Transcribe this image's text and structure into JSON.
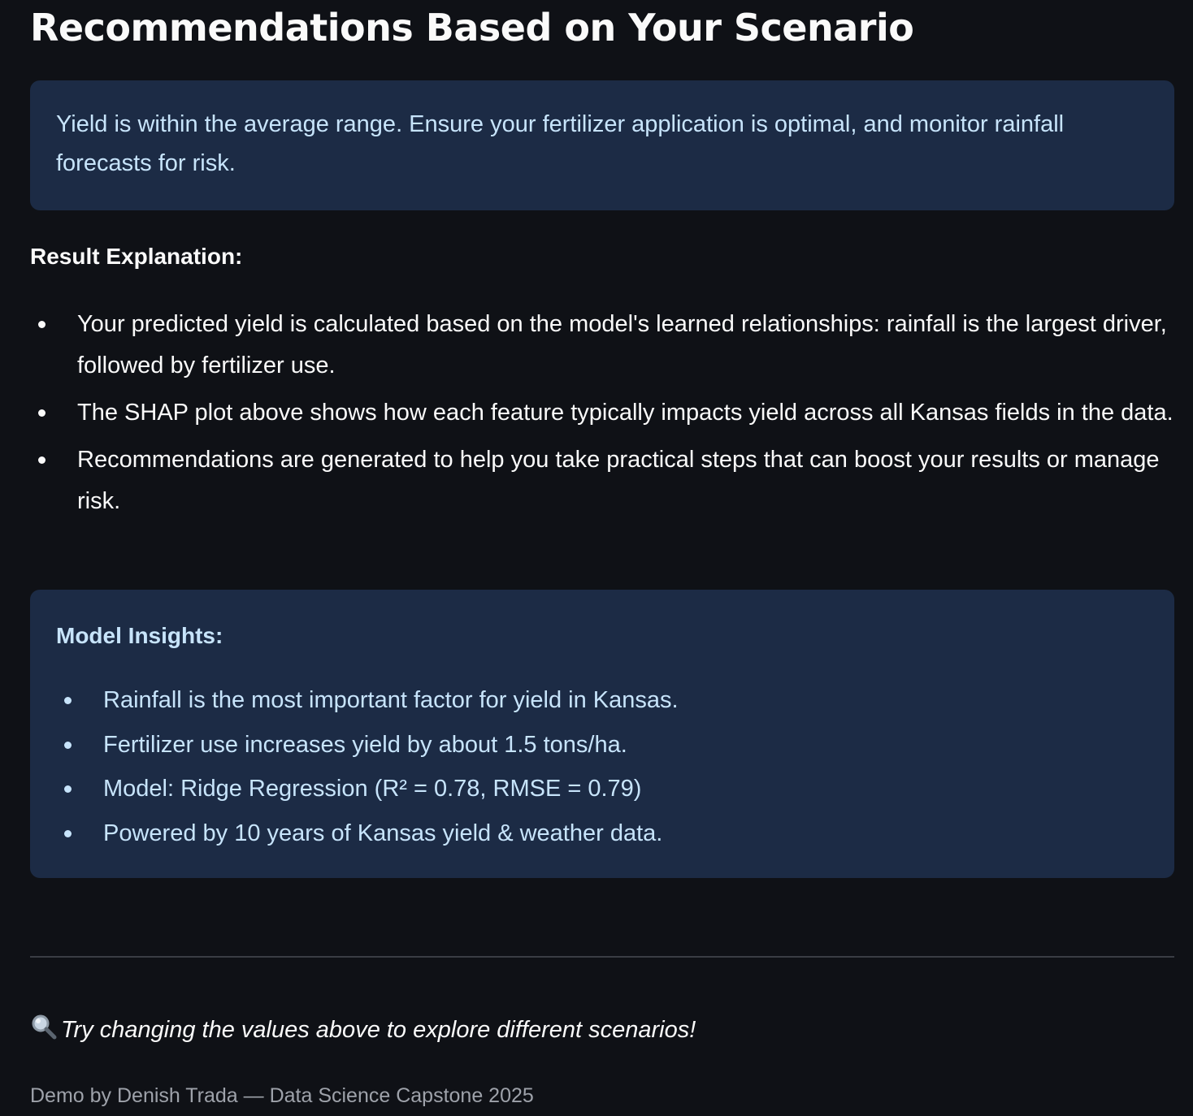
{
  "header": {
    "title": "Recommendations Based on Your Scenario"
  },
  "recommendation": {
    "text": "Yield is within the average range. Ensure your fertilizer application is optimal, and monitor rainfall forecasts for risk."
  },
  "explanation": {
    "heading": "Result Explanation:",
    "items": [
      "Your predicted yield is calculated based on the model's learned relationships: rainfall is the largest driver, followed by fertilizer use.",
      "The SHAP plot above shows how each feature typically impacts yield across all Kansas fields in the data.",
      "Recommendations are generated to help you take practical steps that can boost your results or manage risk."
    ]
  },
  "insights": {
    "heading": "Model Insights:",
    "items": [
      "Rainfall is the most important factor for yield in Kansas.",
      "Fertilizer use increases yield by about 1.5 tons/ha.",
      "Model: Ridge Regression (R² = 0.78, RMSE = 0.79)",
      "Powered by 10 years of Kansas yield & weather data."
    ]
  },
  "tip": {
    "icon": "magnifying-glass-icon",
    "text": "Try changing the values above to explore different scenarios!"
  },
  "footer": {
    "text": "Demo by Denish Trada — Data Science Capstone 2025"
  },
  "colors": {
    "background": "#0f1116",
    "info_box": "#1c2b45",
    "info_text": "#c7e4fb"
  }
}
